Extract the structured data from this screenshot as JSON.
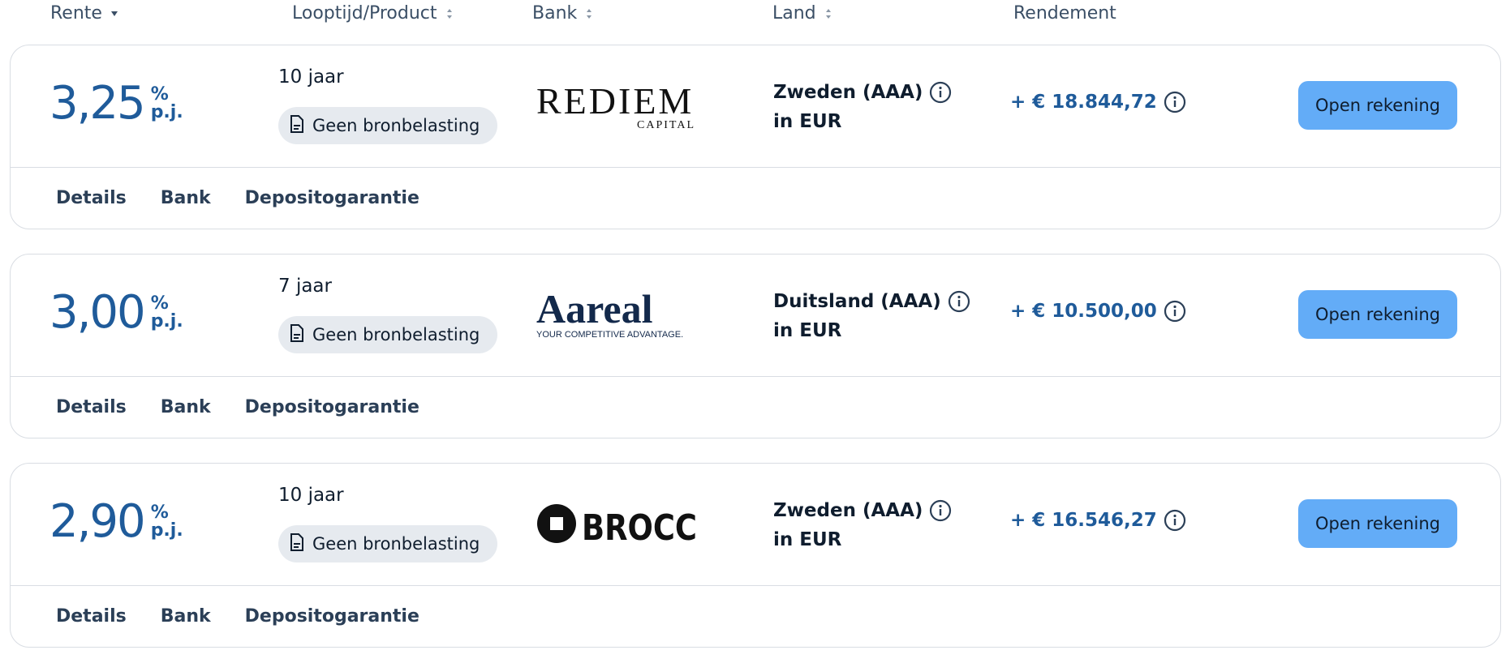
{
  "header": {
    "rente": "Rente",
    "looptijd": "Looptijd/Product",
    "bank": "Bank",
    "land": "Land",
    "rendement": "Rendement"
  },
  "icons": {
    "sort_active": "caret-down-icon",
    "sort_inactive": "sort-icon",
    "info": "info-icon",
    "document": "document-icon"
  },
  "colors": {
    "rate_blue": "#1f5b9a",
    "button_blue": "#63acf7",
    "pill_gray": "#e6eaef",
    "border": "#d9dde3"
  },
  "offers": [
    {
      "rate": "3,25",
      "unit_pct": "%",
      "unit_pj": "p.j.",
      "term": "10 jaar",
      "product": "Geen bronbelasting",
      "bank": {
        "main": "REDIEM",
        "sub": "CAPITAL"
      },
      "country": "Zweden (AAA)",
      "currency": "in EUR",
      "yield": "+ € 18.844,72",
      "button": "Open rekening",
      "tabs": {
        "details": "Details",
        "bank": "Bank",
        "guarantee": "Depositogarantie"
      }
    },
    {
      "rate": "3,00",
      "unit_pct": "%",
      "unit_pj": "p.j.",
      "term": "7 jaar",
      "product": "Geen bronbelasting",
      "bank": {
        "main": "Aareal",
        "sub": "YOUR COMPETITIVE ADVANTAGE."
      },
      "country": "Duitsland (AAA)",
      "currency": "in EUR",
      "yield": "+ € 10.500,00",
      "button": "Open rekening",
      "tabs": {
        "details": "Details",
        "bank": "Bank",
        "guarantee": "Depositogarantie"
      }
    },
    {
      "rate": "2,90",
      "unit_pct": "%",
      "unit_pj": "p.j.",
      "term": "10 jaar",
      "product": "Geen bronbelasting",
      "bank": {
        "main": "BROCC"
      },
      "country": "Zweden (AAA)",
      "currency": "in EUR",
      "yield": "+ € 16.546,27",
      "button": "Open rekening",
      "tabs": {
        "details": "Details",
        "bank": "Bank",
        "guarantee": "Depositogarantie"
      }
    }
  ]
}
